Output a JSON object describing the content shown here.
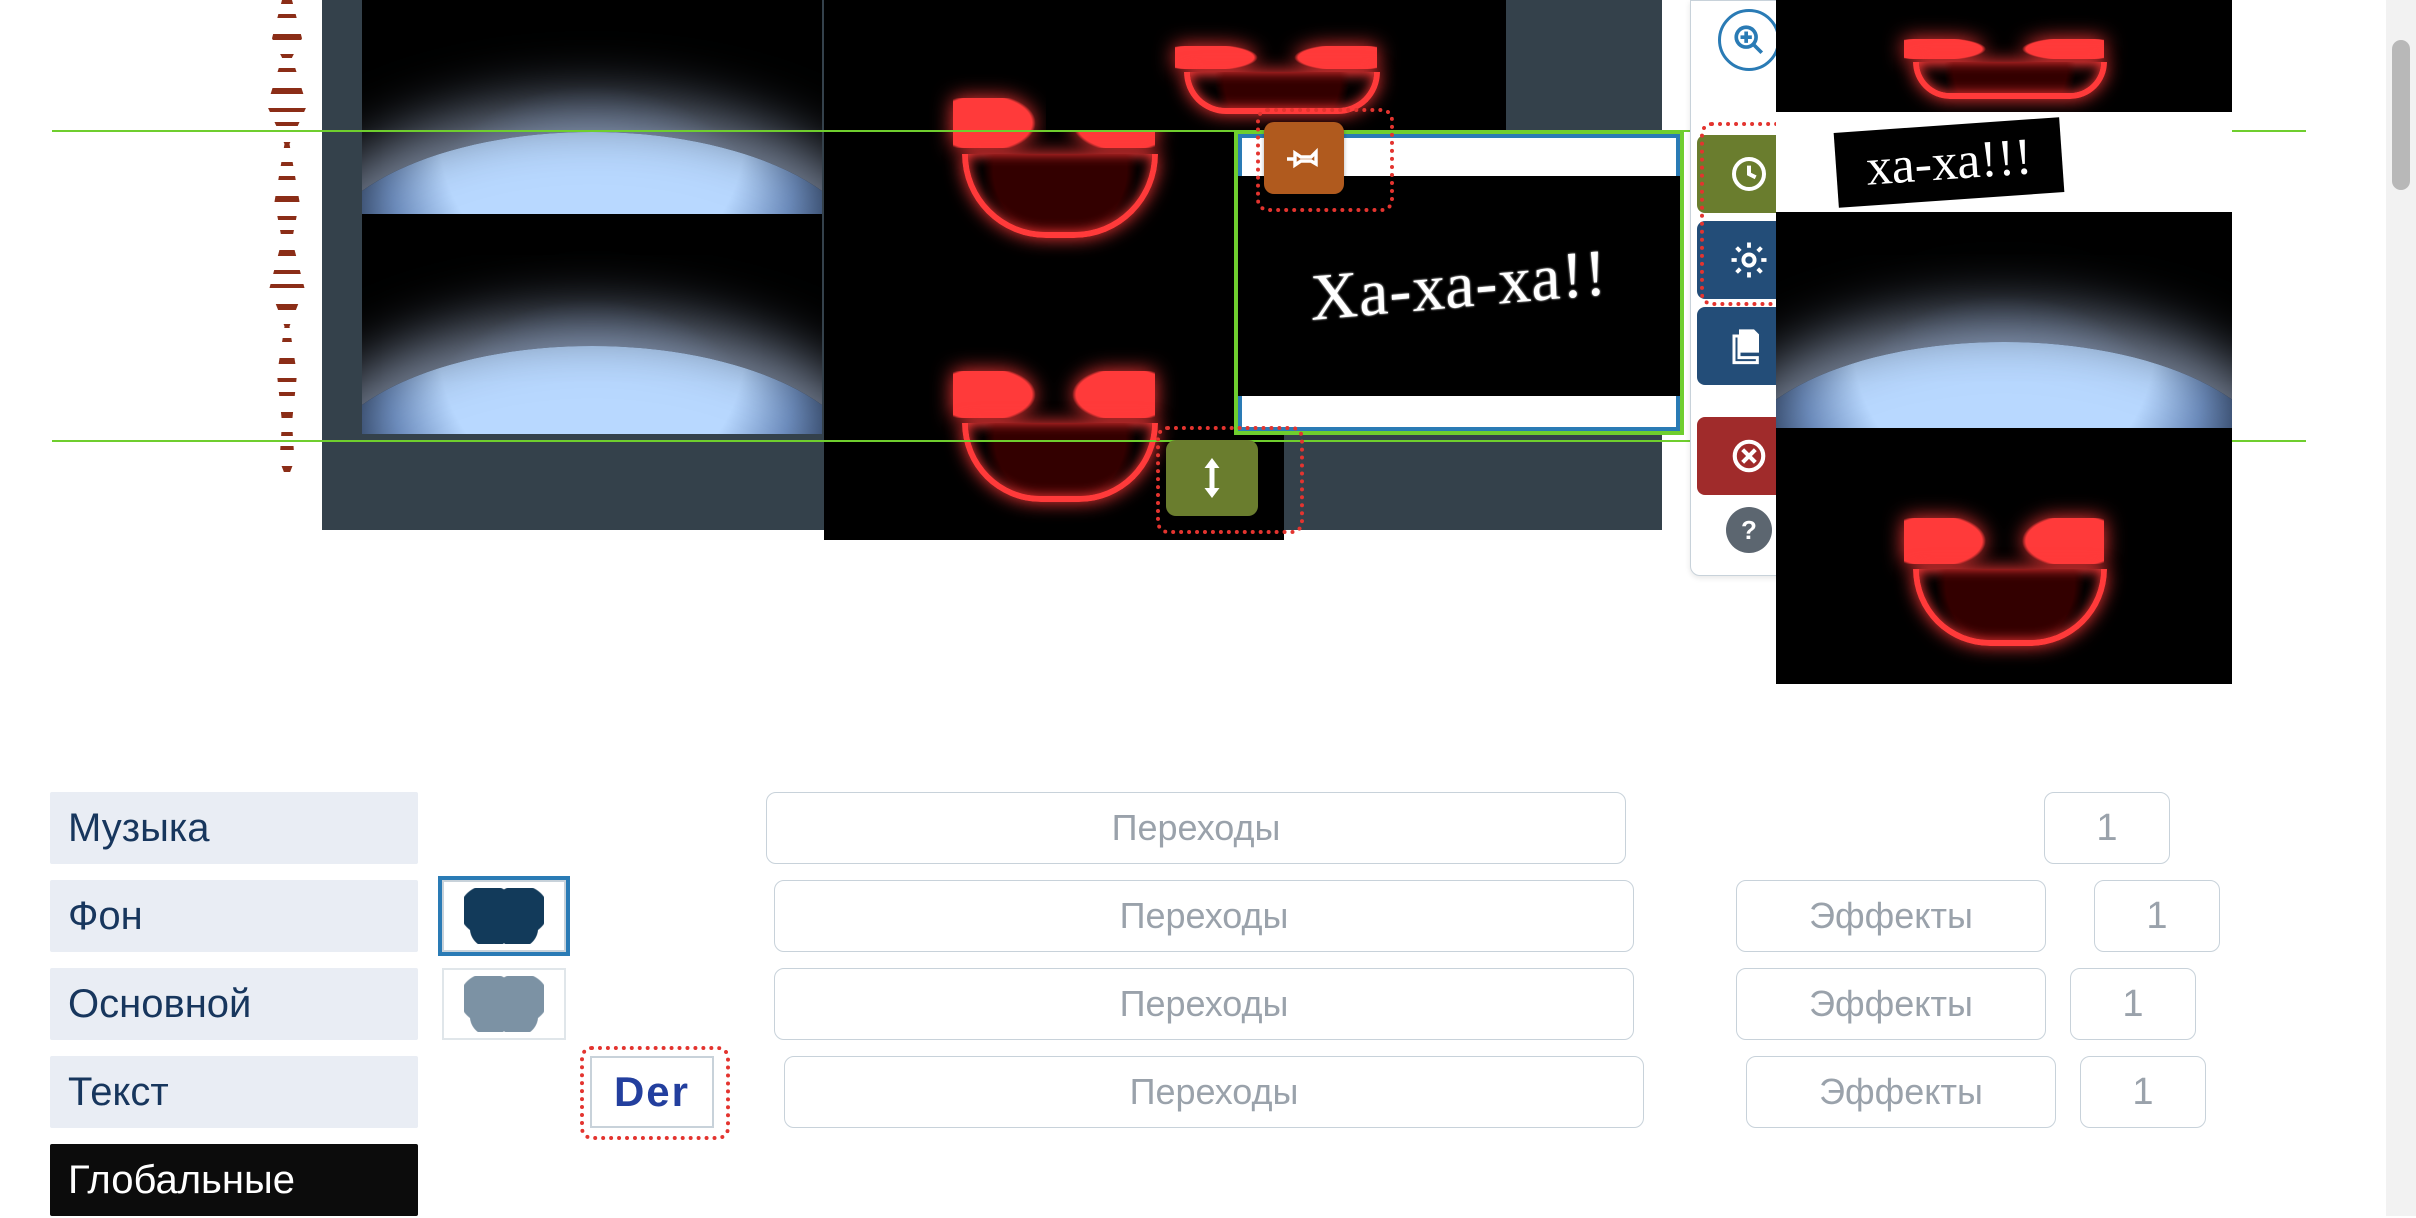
{
  "canvas": {
    "selected_clip_text": "Ха-ха-ха!!",
    "overflow_text": "ха-ха!!!"
  },
  "toolbar": {
    "zoom_in": "zoom-in",
    "duration": "duration",
    "settings": "settings",
    "copy": "copy",
    "delete": "delete",
    "help": "?"
  },
  "rows": [
    {
      "label": "Музыка",
      "thumb": null,
      "transitions": "Переходы",
      "effects": null,
      "num": "1"
    },
    {
      "label": "Фон",
      "thumb": "butterfly",
      "transitions": "Переходы",
      "effects": "Эффекты",
      "num": "1"
    },
    {
      "label": "Основной",
      "thumb": "butterfly-faded",
      "transitions": "Переходы",
      "effects": "Эффекты",
      "num": "1"
    },
    {
      "label": "Текст",
      "thumb": "der",
      "transitions": "Переходы",
      "effects": "Эффекты",
      "num": "1"
    },
    {
      "label": "Глобальные",
      "thumb": null,
      "transitions": null,
      "effects": null,
      "num": null
    }
  ],
  "thumb_text": {
    "der": "Der"
  }
}
